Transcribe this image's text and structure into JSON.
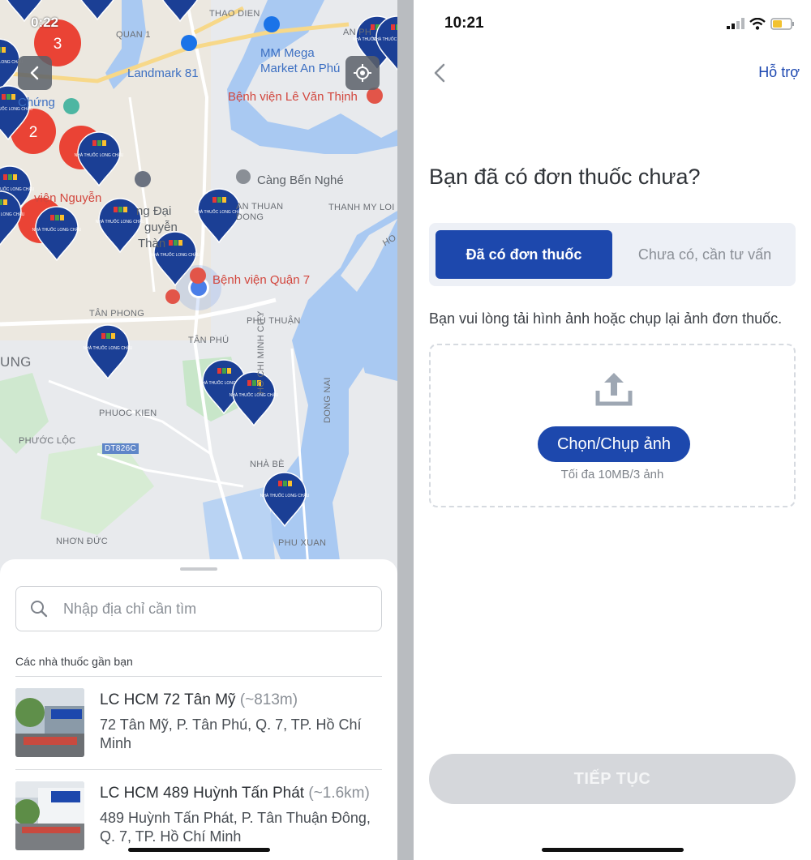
{
  "left": {
    "status_time": "0:22",
    "map": {
      "labels": [
        "QUAN 1",
        "THAO DIEN",
        "AN PH",
        "AN THUAN DONG",
        "THANH MY LOI",
        "TÂN PHONG",
        "PHÚ THUẬN",
        "TÂN PHÚ",
        "UNG",
        "PHUOC KIEN",
        "PHƯỚC LỘC",
        "DT826C",
        "NHÀ BÈ",
        "NHƠN ĐỨC",
        "PHU XUAN",
        "HO CHI MINH CITY",
        "DONG NAI",
        "HO"
      ],
      "pois": [
        "MM Mega Market An Phú",
        "Landmark 81",
        "Bệnh viện Lê Văn Thịnh",
        "Chứng",
        "Càng Bến Nghé",
        "viện Nguyễn",
        "ng Đại",
        "guyễn",
        "Thàn",
        "Bệnh viện Quận 7"
      ],
      "clusters": [
        "3",
        "2"
      ],
      "pin_text": "NHÀ THUỐC LONG CHÂU"
    },
    "search": {
      "placeholder": "Nhập địa chỉ cần tìm"
    },
    "nearby_title": "Các nhà thuốc gần bạn",
    "stores": [
      {
        "name": "LC HCM 72 Tân Mỹ",
        "distance": "(~813m)",
        "address": "72 Tân Mỹ, P. Tân Phú, Q. 7, TP. Hồ Chí Minh"
      },
      {
        "name": "LC HCM 489 Huỳnh Tấn Phát",
        "distance": "(~1.6km)",
        "address": "489 Huỳnh Tấn Phát, P. Tân Thuận Đông, Q. 7, TP. Hồ Chí Minh"
      }
    ]
  },
  "right": {
    "status_time": "10:21",
    "support_label": "Hỗ trợ",
    "question": "Bạn đã có đơn thuốc chưa?",
    "tabs": {
      "has": "Đã có đơn thuốc",
      "none": "Chưa có, cần tư vấn"
    },
    "instruction": "Bạn vui lòng tải hình ảnh hoặc chụp lại ảnh đơn thuốc.",
    "upload": {
      "button": "Chọn/Chụp ảnh",
      "limit": "Tối đa 10MB/3 ảnh"
    },
    "continue_label": "TIẾP TỤC"
  },
  "colors": {
    "primary": "#1d48ad",
    "map_water": "#a9c9f2",
    "cluster_red": "#ea4335"
  }
}
